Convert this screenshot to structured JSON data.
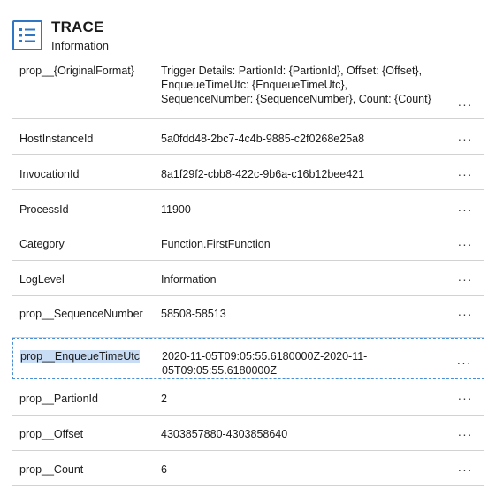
{
  "header": {
    "icon": "list-icon",
    "title": "TRACE",
    "subtitle": "Information"
  },
  "rows": [
    {
      "key": "prop__{OriginalFormat}",
      "value": "Trigger Details: PartionId: {PartionId}, Offset: {Offset}, EnqueueTimeUtc: {EnqueueTimeUtc}, SequenceNumber: {SequenceNumber}, Count: {Count}",
      "more": "···"
    },
    {
      "key": "HostInstanceId",
      "value": "5a0fdd48-2bc7-4c4b-9885-c2f0268e25a8",
      "more": "···"
    },
    {
      "key": "InvocationId",
      "value": "8a1f29f2-cbb8-422c-9b6a-c16b12bee421",
      "more": "···"
    },
    {
      "key": "ProcessId",
      "value": "11900",
      "more": "···"
    },
    {
      "key": "Category",
      "value": "Function.FirstFunction",
      "more": "···"
    },
    {
      "key": "LogLevel",
      "value": "Information",
      "more": "···"
    },
    {
      "key": "prop__SequenceNumber",
      "value": "58508-58513",
      "more": "···"
    },
    {
      "key": "prop__EnqueueTimeUtc",
      "value": "2020-11-05T09:05:55.6180000Z-2020-11-05T09:05:55.6180000Z",
      "more": "···",
      "selected": true
    },
    {
      "key": "prop__PartionId",
      "value": "2",
      "more": "···"
    },
    {
      "key": "prop__Offset",
      "value": "4303857880-4303858640",
      "more": "···"
    },
    {
      "key": "prop__Count",
      "value": "6",
      "more": "···"
    }
  ]
}
